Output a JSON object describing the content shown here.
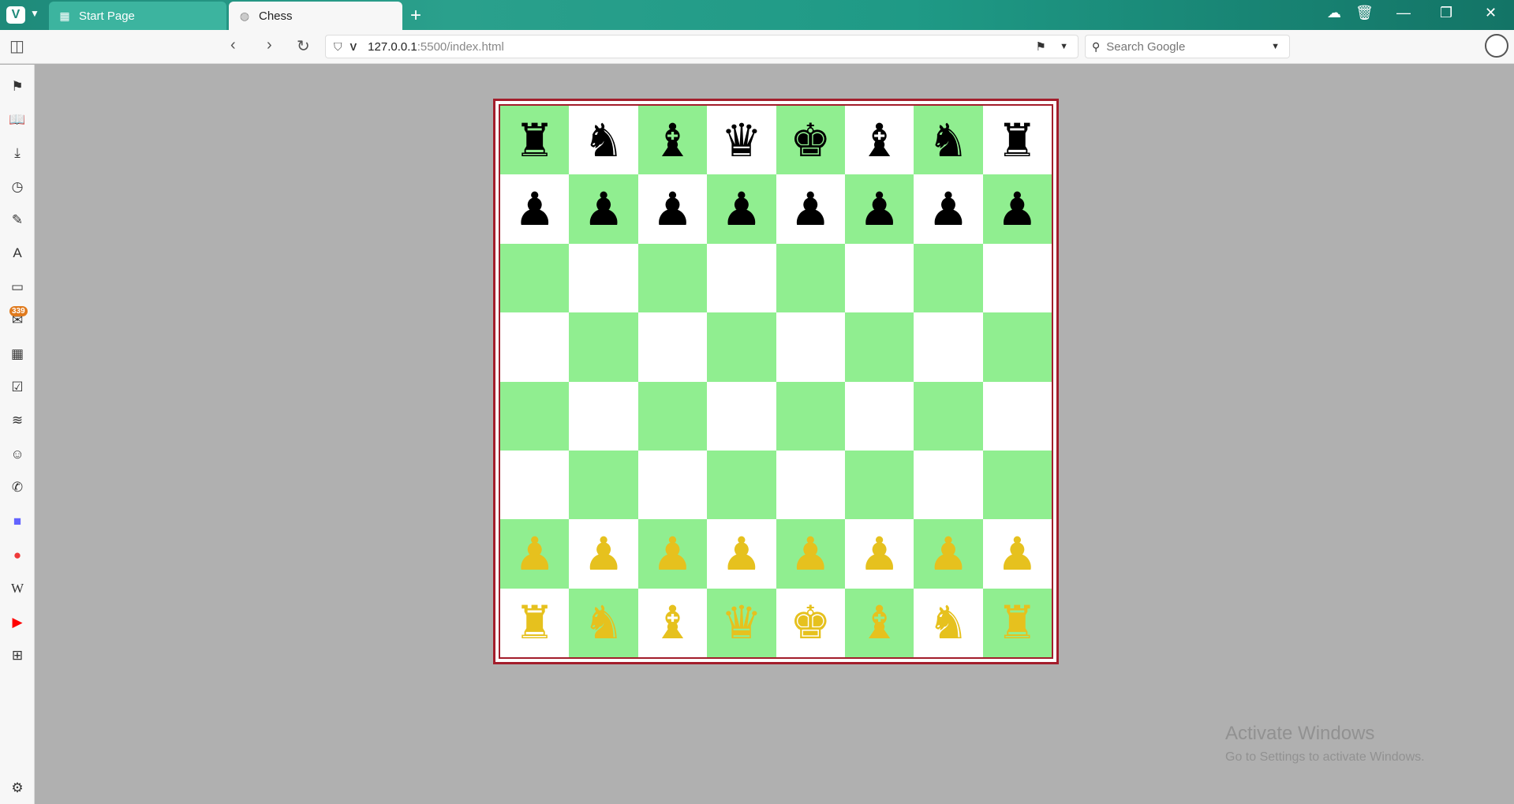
{
  "browser": {
    "tabs": [
      {
        "label": "Start Page",
        "active": false
      },
      {
        "label": "Chess",
        "active": true
      }
    ],
    "url_host": "127.0.0.1",
    "url_path": ":5500/index.html",
    "search_placeholder": "Search Google",
    "mail_badge": "339"
  },
  "board": {
    "light_color": "#ffffff",
    "dark_color": "#90ee90",
    "border_color": "#a31d2b",
    "black_color": "#000000",
    "white_color": "#e6c11e",
    "ranks": [
      [
        "♜",
        "♞",
        "♝",
        "♛",
        "♚",
        "♝",
        "♞",
        "♜"
      ],
      [
        "♟",
        "♟",
        "♟",
        "♟",
        "♟",
        "♟",
        "♟",
        "♟"
      ],
      [
        "",
        "",
        "",
        "",
        "",
        "",
        "",
        ""
      ],
      [
        "",
        "",
        "",
        "",
        "",
        "",
        "",
        ""
      ],
      [
        "",
        "",
        "",
        "",
        "",
        "",
        "",
        ""
      ],
      [
        "",
        "",
        "",
        "",
        "",
        "",
        "",
        ""
      ],
      [
        "♟",
        "♟",
        "♟",
        "♟",
        "♟",
        "♟",
        "♟",
        "♟"
      ],
      [
        "♜",
        "♞",
        "♝",
        "♛",
        "♚",
        "♝",
        "♞",
        "♜"
      ]
    ]
  },
  "watermark": {
    "title": "Activate Windows",
    "subtitle": "Go to Settings to activate Windows."
  }
}
